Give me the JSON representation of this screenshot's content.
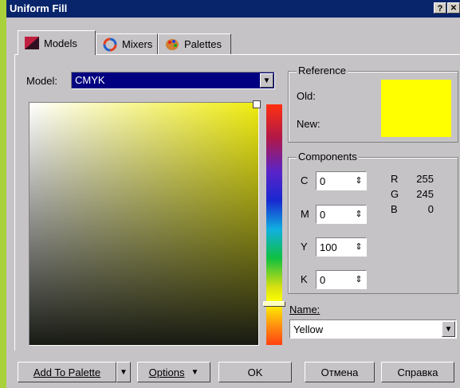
{
  "window": {
    "title": "Uniform Fill",
    "help_glyph": "?",
    "close_glyph": "✕"
  },
  "tabs": [
    {
      "label": "Models",
      "icon": "models-icon",
      "active": true
    },
    {
      "label": "Mixers",
      "icon": "mixers-icon",
      "active": false
    },
    {
      "label": "Palettes",
      "icon": "palettes-icon",
      "active": false
    }
  ],
  "model": {
    "label": "Model:",
    "value": "CMYK"
  },
  "reference": {
    "title": "Reference",
    "old_label": "Old:",
    "new_label": "New:",
    "old_color": "#ffff00",
    "new_color": "#ffff00"
  },
  "components": {
    "title": "Components",
    "cmyk": [
      {
        "label": "C",
        "value": "0"
      },
      {
        "label": "M",
        "value": "0"
      },
      {
        "label": "Y",
        "value": "100"
      },
      {
        "label": "K",
        "value": "0"
      }
    ],
    "rgb": [
      {
        "label": "R",
        "value": "255"
      },
      {
        "label": "G",
        "value": "245"
      },
      {
        "label": "B",
        "value": "0"
      }
    ]
  },
  "name": {
    "label": "Name:",
    "value": "Yellow"
  },
  "buttons": {
    "add_to_palette": "Add To Palette",
    "options": "Options",
    "ok": "OK",
    "cancel": "Отмена",
    "help": "Справка"
  },
  "colors": {
    "accent": "#08246b",
    "selection": "#000080",
    "face": "#c6c3c6"
  }
}
